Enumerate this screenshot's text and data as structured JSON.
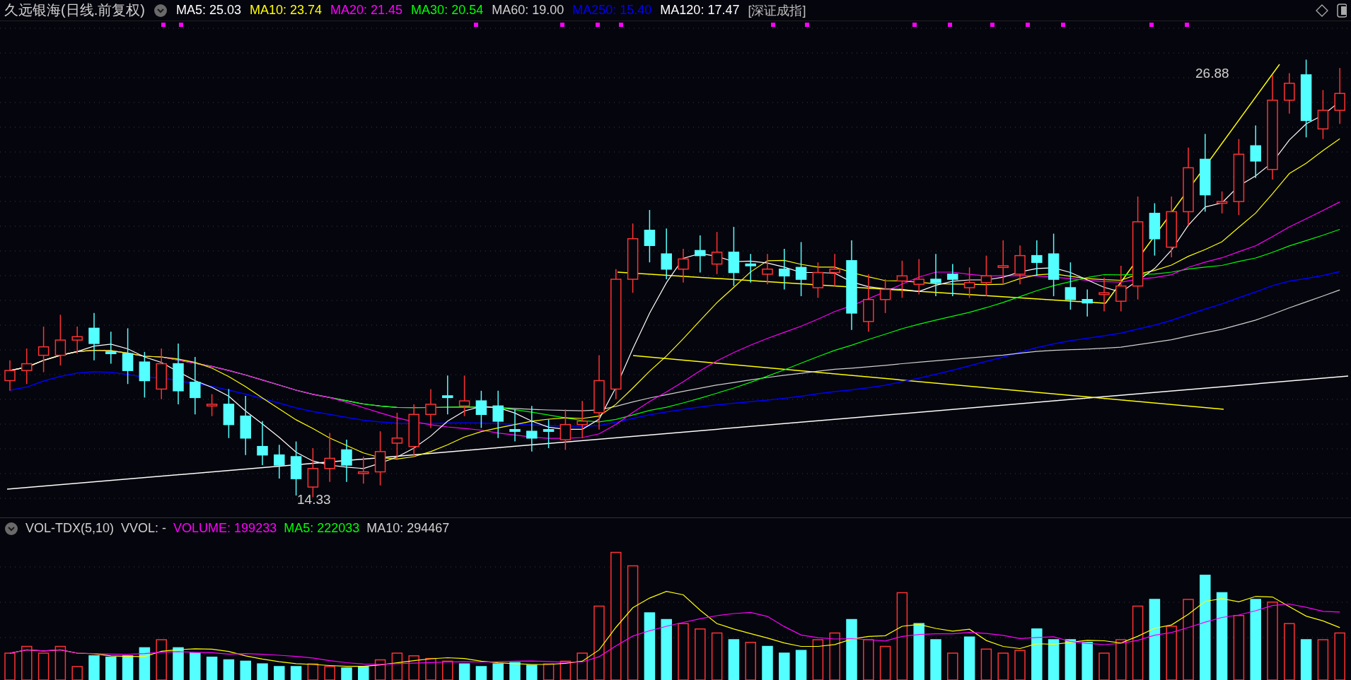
{
  "header": {
    "title": "久远银海(日线.前复权)",
    "indicators": [
      {
        "label": "MA5: 25.03",
        "color": "#ffffff"
      },
      {
        "label": "MA10: 23.74",
        "color": "#ffff00"
      },
      {
        "label": "MA20: 21.45",
        "color": "#ff00ff"
      },
      {
        "label": "MA30: 20.54",
        "color": "#00ff00"
      },
      {
        "label": "MA60: 19.00",
        "color": "#d0d0d0"
      },
      {
        "label": "MA250: 15.40",
        "color": "#0000ff"
      },
      {
        "label": "MA120: 17.47",
        "color": "#ffffff"
      }
    ],
    "index_label": "[深证成指]"
  },
  "chart": {
    "high_label": "26.88",
    "low_label": "14.33"
  },
  "volume_header": {
    "name": "VOL-TDX(5,10)",
    "vvol": "VVOL: -",
    "indicators": [
      {
        "label": "VOLUME: 199233",
        "color": "#ff00ff"
      },
      {
        "label": "MA5: 222033",
        "color": "#00ff00"
      },
      {
        "label": "MA10: 294467",
        "color": "#d0d0d0"
      }
    ]
  }
}
